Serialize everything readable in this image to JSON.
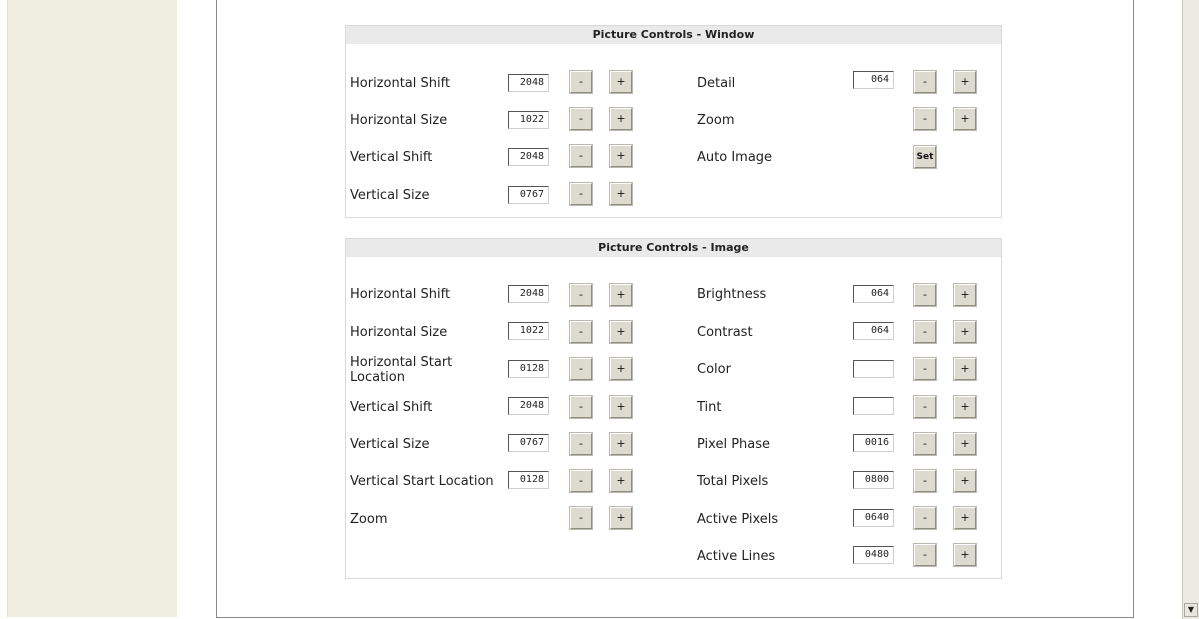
{
  "window_panel": {
    "title": "Picture Controls - Window",
    "left": [
      {
        "label": "Horizontal Shift",
        "value": "2048",
        "minus": "-",
        "plus": "+"
      },
      {
        "label": "Horizontal Size",
        "value": "1022",
        "minus": "-",
        "plus": "+"
      },
      {
        "label": "Vertical Shift",
        "value": "2048",
        "minus": "-",
        "plus": "+"
      },
      {
        "label": "Vertical Size",
        "value": "0767",
        "minus": "-",
        "plus": "+"
      }
    ],
    "right": [
      {
        "label": "Detail",
        "value": "064",
        "minus": "-",
        "plus": "+"
      },
      {
        "label": "Zoom",
        "minus": "-",
        "plus": "+"
      },
      {
        "label": "Auto Image",
        "set": "Set"
      }
    ]
  },
  "image_panel": {
    "title": "Picture Controls - Image",
    "left": [
      {
        "label": "Horizontal Shift",
        "value": "2048",
        "minus": "-",
        "plus": "+"
      },
      {
        "label": "Horizontal Size",
        "value": "1022",
        "minus": "-",
        "plus": "+"
      },
      {
        "label": "Horizontal Start Location",
        "value": "0128",
        "minus": "-",
        "plus": "+"
      },
      {
        "label": "Vertical Shift",
        "value": "2048",
        "minus": "-",
        "plus": "+"
      },
      {
        "label": "Vertical Size",
        "value": "0767",
        "minus": "-",
        "plus": "+"
      },
      {
        "label": "Vertical Start Location",
        "value": "0128",
        "minus": "-",
        "plus": "+"
      },
      {
        "label": "Zoom",
        "minus": "-",
        "plus": "+"
      }
    ],
    "right": [
      {
        "label": "Brightness",
        "value": "064",
        "minus": "-",
        "plus": "+"
      },
      {
        "label": "Contrast",
        "value": "064",
        "minus": "-",
        "plus": "+"
      },
      {
        "label": "Color",
        "value": "",
        "minus": "-",
        "plus": "+"
      },
      {
        "label": "Tint",
        "value": "",
        "minus": "-",
        "plus": "+"
      },
      {
        "label": "Pixel Phase",
        "value": "0016",
        "minus": "-",
        "plus": "+"
      },
      {
        "label": "Total Pixels",
        "value": "0800",
        "minus": "-",
        "plus": "+"
      },
      {
        "label": "Active Pixels",
        "value": "0640",
        "minus": "-",
        "plus": "+"
      },
      {
        "label": "Active Lines",
        "value": "0480",
        "minus": "-",
        "plus": "+"
      }
    ]
  },
  "scrollbar": {
    "down_arrow": "▼"
  }
}
